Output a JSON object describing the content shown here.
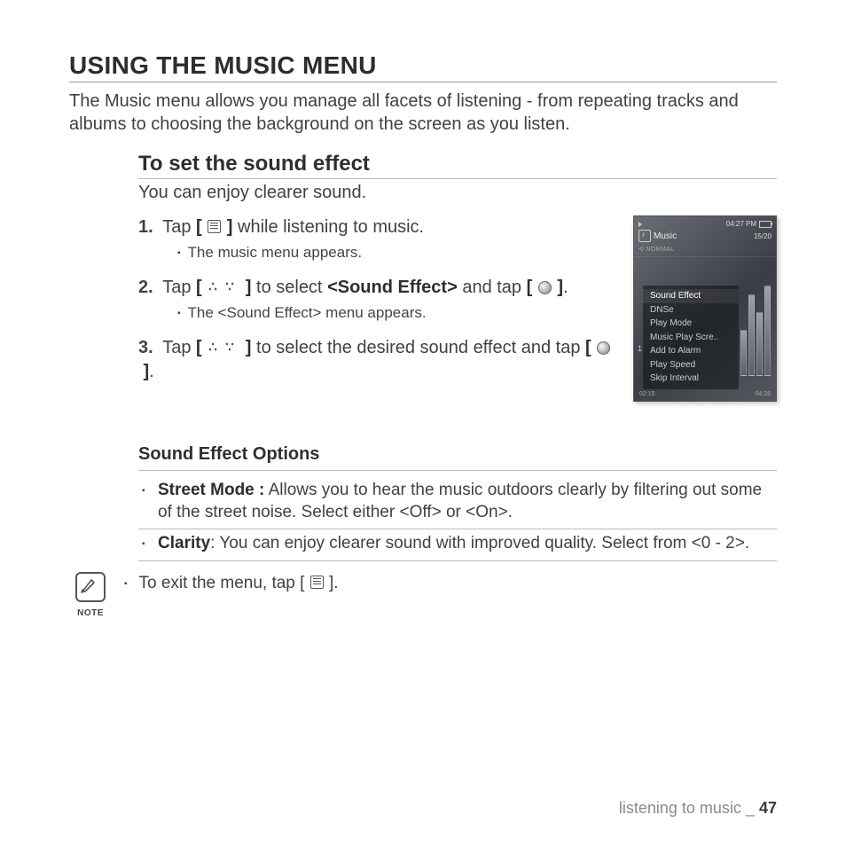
{
  "title": "USING THE MUSIC MENU",
  "intro": "The Music menu allows you manage all facets of listening - from repeating tracks and albums to choosing the background on the screen as you listen.",
  "section_heading": "To set the sound effect",
  "section_lead": "You can enjoy clearer sound.",
  "steps": [
    {
      "num": "1.",
      "pre": "Tap ",
      "icon": "menu",
      "post": " while listening to music.",
      "sub": "The music menu appears."
    },
    {
      "num": "2.",
      "pre": "Tap ",
      "icon": "updown",
      "mid1": " to select ",
      "target": "<Sound Effect>",
      "mid2": " and tap ",
      "icon2": "circle",
      "post": ".",
      "sub": "The <Sound Effect> menu appears."
    },
    {
      "num": "3.",
      "pre": "Tap ",
      "icon": "updown",
      "mid1": " to select the desired sound effect and tap ",
      "icon2": "circle",
      "post": "."
    }
  ],
  "options_heading": "Sound Effect Options",
  "options": [
    {
      "label": "Street Mode :",
      "text": " Allows you to hear the music outdoors clearly by filtering out some of the street noise. Select either <Off> or <On>."
    },
    {
      "label": "Clarity",
      "text": ": You can enjoy clearer sound with improved quality. Select from <0 - 2>."
    }
  ],
  "note_label": "NOTE",
  "note_pre": "To exit the menu, tap [ ",
  "note_post": " ].",
  "device": {
    "time": "04:27 PM",
    "app": "Music",
    "count": "15/20",
    "normal": "NORMAL",
    "menu": [
      "Sound Effect",
      "DNSe",
      "Play Mode",
      "Music Play Scre..",
      "Add to Alarm",
      "Play Speed",
      "Skip Interval"
    ],
    "one": "1",
    "elapsed": "02:15",
    "total": "04:28"
  },
  "footer_section": "listening to music",
  "footer_sep": "_",
  "footer_page": "47"
}
